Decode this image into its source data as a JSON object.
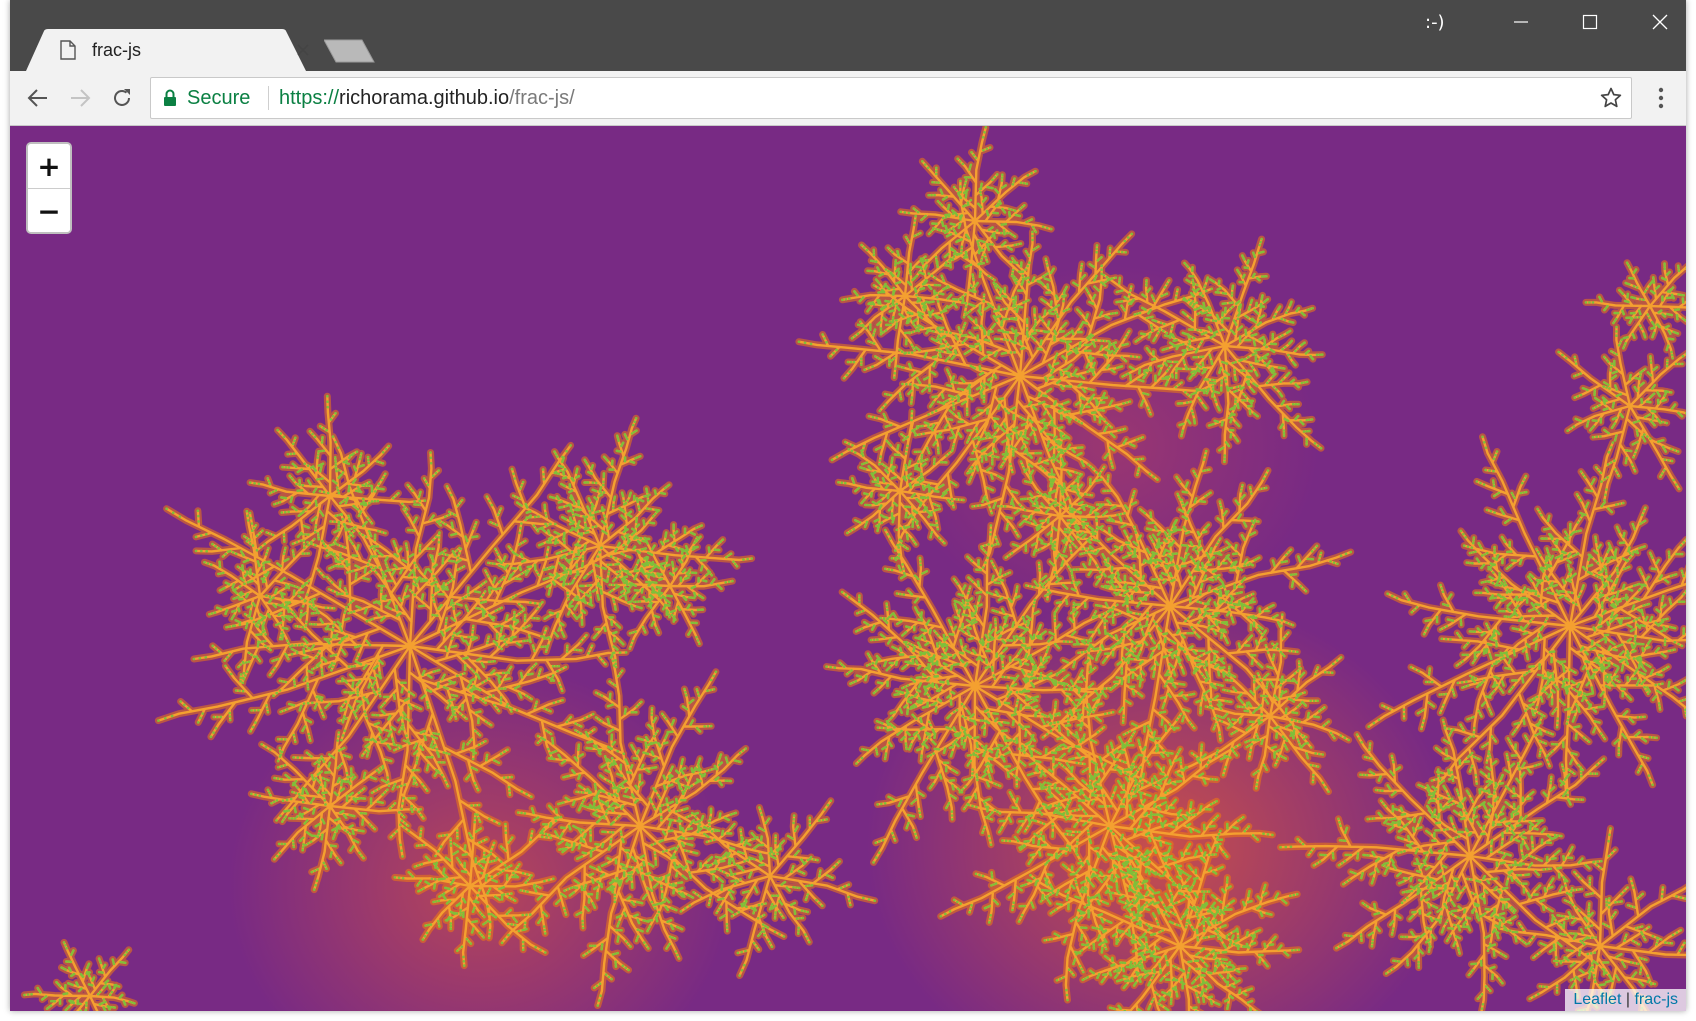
{
  "browser": {
    "tab": {
      "title": "frac-js",
      "icon": "page-icon"
    },
    "profile_label": ":-)",
    "window_controls": [
      "minimize-icon",
      "maximize-icon",
      "close-icon"
    ],
    "toolbar": {
      "secure_label": "Secure",
      "url": {
        "scheme": "https://",
        "host": "richorama.github.io",
        "path": "/frac-js/"
      }
    }
  },
  "map": {
    "zoom_in_label": "+",
    "zoom_out_label": "−",
    "attribution": {
      "leaflet": "Leaflet",
      "separator": " | ",
      "source": "frac-js"
    }
  },
  "colors": {
    "background_purple": "#782a84",
    "fractal_orange": "#f07a10",
    "fractal_light": "#f4a030",
    "secure_green": "#0b8043"
  }
}
